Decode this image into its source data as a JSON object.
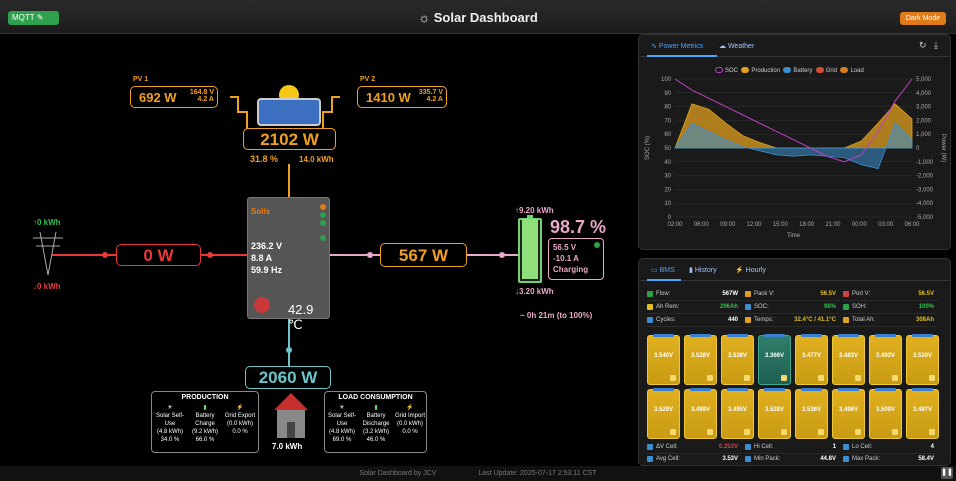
{
  "header": {
    "mqtt_label": "MQTT",
    "title": "Solar Dashboard",
    "mode_button": "Dark Mode"
  },
  "pv1": {
    "label": "PV 1",
    "power": "692 W",
    "voltage": "164.8 V",
    "current": "4.2 A"
  },
  "pv2": {
    "label": "PV 2",
    "power": "1410 W",
    "voltage": "335.7 V",
    "current": "4.2 A"
  },
  "solar": {
    "total": "2102 W",
    "percent": "31.8 %",
    "energy": "14.0 kWh"
  },
  "grid": {
    "power": "0 W",
    "import_today": "0 kWh",
    "export_today": "0 kWh"
  },
  "inverter": {
    "name": "Solis",
    "voltage": "236.2 V",
    "current": "8.8 A",
    "frequency": "59.9 Hz",
    "temperature": "42.9 ℃"
  },
  "battery_flow": {
    "power": "567 W"
  },
  "battery": {
    "charge_today": "9.20 kWh",
    "soc": "98.7 %",
    "voltage": "56.5 V",
    "current": "-10.1 A",
    "status": "Charging",
    "discharge_today": "3.20 kWh",
    "time_to_full": "~ 0h 21m (to 100%)"
  },
  "load": {
    "power": "2060 W",
    "energy": "7.0 kWh"
  },
  "production_summary": {
    "title": "PRODUCTION",
    "items": [
      {
        "label": "Solar Self-Use",
        "kwh": "(4.8 kWh)",
        "pct": "34.0 %"
      },
      {
        "label": "Battery Charge",
        "kwh": "(9.2 kWh)",
        "pct": "66.0 %"
      },
      {
        "label": "Grid Export",
        "kwh": "(0.0 kWh)",
        "pct": "0.0 %"
      }
    ]
  },
  "consumption_summary": {
    "title": "LOAD CONSUMPTION",
    "items": [
      {
        "label": "Solar Self-Use",
        "kwh": "(4.8 kWh)",
        "pct": "69.0 %"
      },
      {
        "label": "Battery Discharge",
        "kwh": "(3.2 kWh)",
        "pct": "46.0 %"
      },
      {
        "label": "Grid Import",
        "kwh": "(0.0 kWh)",
        "pct": "0.0 %"
      }
    ]
  },
  "chart_panel": {
    "tabs": [
      "Power Metrics",
      "Weather"
    ]
  },
  "chart_data": {
    "type": "line",
    "legend": [
      "SOC",
      "Production",
      "Battery",
      "Grid",
      "Load"
    ],
    "colors": {
      "SOC": "#c040c0",
      "Production": "#e0a020",
      "Battery": "#3b8fd0",
      "Grid": "#d05030",
      "Load": "#d08020"
    },
    "x": [
      "02:00",
      "06:00",
      "09:00",
      "12:00",
      "15:00",
      "18:00",
      "21:00",
      "00:00",
      "03:00",
      "06:00"
    ],
    "ylabel_left": "SOC (%)",
    "ylabel_right": "Power (W)",
    "xlabel": "Time",
    "ylim_left": [
      0,
      100
    ],
    "ylim_right": [
      -5000,
      5000
    ],
    "yticks_left": [
      "100",
      "90",
      "80",
      "70",
      "60",
      "50",
      "40",
      "30",
      "20",
      "10",
      "0"
    ],
    "yticks_right": [
      "5,000",
      "4,000",
      "3,000",
      "2,000",
      "1,000",
      "0",
      "-1,000",
      "-2,000",
      "-3,000",
      "-4,000",
      "-5,000"
    ],
    "soc": [
      100,
      92,
      86,
      80,
      74,
      68,
      62,
      56,
      50,
      44,
      40,
      45,
      62,
      84,
      100
    ],
    "production": [
      0,
      3200,
      2800,
      1800,
      900,
      400,
      0,
      0,
      0,
      0,
      0,
      500,
      1800,
      3200,
      2100
    ],
    "battery": [
      0,
      1800,
      1200,
      600,
      100,
      -200,
      -500,
      -600,
      -500,
      -600,
      -700,
      -1200,
      -1500,
      1800,
      567
    ]
  },
  "bms_panel": {
    "tabs": [
      "BMS",
      "History",
      "Hourly"
    ],
    "rows": [
      [
        {
          "k": "Flow:",
          "v": "567W"
        },
        {
          "k": "Pack V:",
          "v": "56.5V"
        },
        {
          "k": "Port V:",
          "v": "56.5V"
        }
      ],
      [
        {
          "k": "Ah Rem:",
          "v": "296Ah"
        },
        {
          "k": "SOC:",
          "v": "98%"
        },
        {
          "k": "SOH:",
          "v": "100%"
        }
      ],
      [
        {
          "k": "Cycles:",
          "v": "440"
        },
        {
          "k": "Temps:",
          "v": "32.4°C / 41.1°C"
        },
        {
          "k": "Total Ah:",
          "v": "308Ah"
        }
      ]
    ],
    "cells_row1": [
      "3.540V",
      "3.528V",
      "3.538V",
      "3.366V",
      "3.477V",
      "3.483V",
      "3.493V",
      "3.510V"
    ],
    "cells_row2": [
      "3.529V",
      "3.499V",
      "3.495V",
      "3.528V",
      "3.536V",
      "3.496V",
      "3.509V",
      "3.487V"
    ],
    "bottom_rows": [
      [
        {
          "k": "ΔV Cell:",
          "v": "0.253V"
        },
        {
          "k": "Hi Cell:",
          "v": "1"
        },
        {
          "k": "Lo Cell:",
          "v": "4"
        }
      ],
      [
        {
          "k": "Avg Cell:",
          "v": "3.53V"
        },
        {
          "k": "Min Pack:",
          "v": "44.8V"
        },
        {
          "k": "Max Pack:",
          "v": "58.4V"
        }
      ]
    ]
  },
  "footer": {
    "left": "Solar Dashboard by JCV",
    "right": "Last Update: 2025-07-17 2:53:11 CST"
  }
}
